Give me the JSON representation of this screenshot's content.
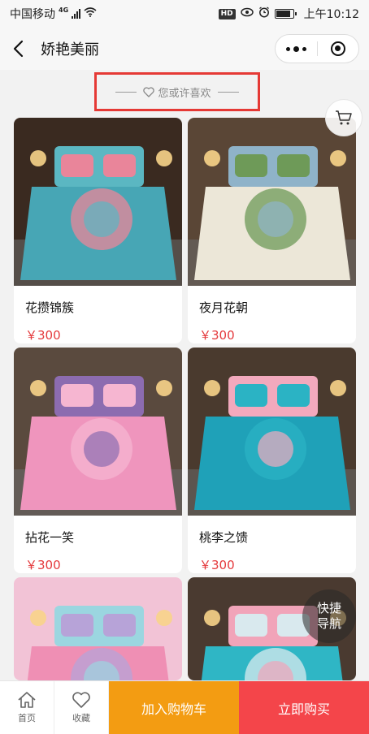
{
  "status_bar": {
    "carrier": "中国移动",
    "network": "4G",
    "hd_badge": "HD",
    "time": "上午10:12",
    "icons": [
      "signal-icon",
      "wifi-icon",
      "eye-icon",
      "alarm-icon",
      "battery-icon"
    ]
  },
  "nav": {
    "title": "娇艳美丽",
    "back_icon": "chevron-left-icon",
    "more_icon": "more-dots-icon",
    "close_icon": "target-icon"
  },
  "section": {
    "title": "您或许喜欢",
    "icon": "heart-icon"
  },
  "float_cart": {
    "icon": "cart-icon"
  },
  "products": [
    {
      "name": "花攒锦簇",
      "price": "￥300",
      "palette": [
        "#47a6b5",
        "#5bb7c2",
        "#e9859a",
        "#3a2a20"
      ]
    },
    {
      "name": "夜月花朝",
      "price": "￥300",
      "palette": [
        "#ece7d8",
        "#8fb3c9",
        "#6e9a58",
        "#5a4636"
      ]
    },
    {
      "name": "拈花一笑",
      "price": "￥300",
      "palette": [
        "#ef95bd",
        "#8c6cb0",
        "#f6b6d1",
        "#5a4a3e"
      ]
    },
    {
      "name": "桃李之馈",
      "price": "￥300",
      "palette": [
        "#1fa1b8",
        "#f2a9bd",
        "#2bb3c4",
        "#4a3a2e"
      ]
    },
    {
      "name": "",
      "price": "",
      "palette": [
        "#ef8fb4",
        "#9bd6e0",
        "#b7a3d8",
        "#f2c3d6"
      ]
    },
    {
      "name": "",
      "price": "",
      "palette": [
        "#2fb6c5",
        "#f1a4b9",
        "#d9e9ee",
        "#4a3a30"
      ]
    }
  ],
  "quick_nav": {
    "line1": "快捷",
    "line2": "导航"
  },
  "bottom_bar": {
    "home_label": "首页",
    "fav_label": "收藏",
    "add_cart_label": "加入购物车",
    "buy_label": "立即购买",
    "colors": {
      "add_cart": "#f39c12",
      "buy": "#f4454a",
      "price": "#e4393c"
    }
  }
}
